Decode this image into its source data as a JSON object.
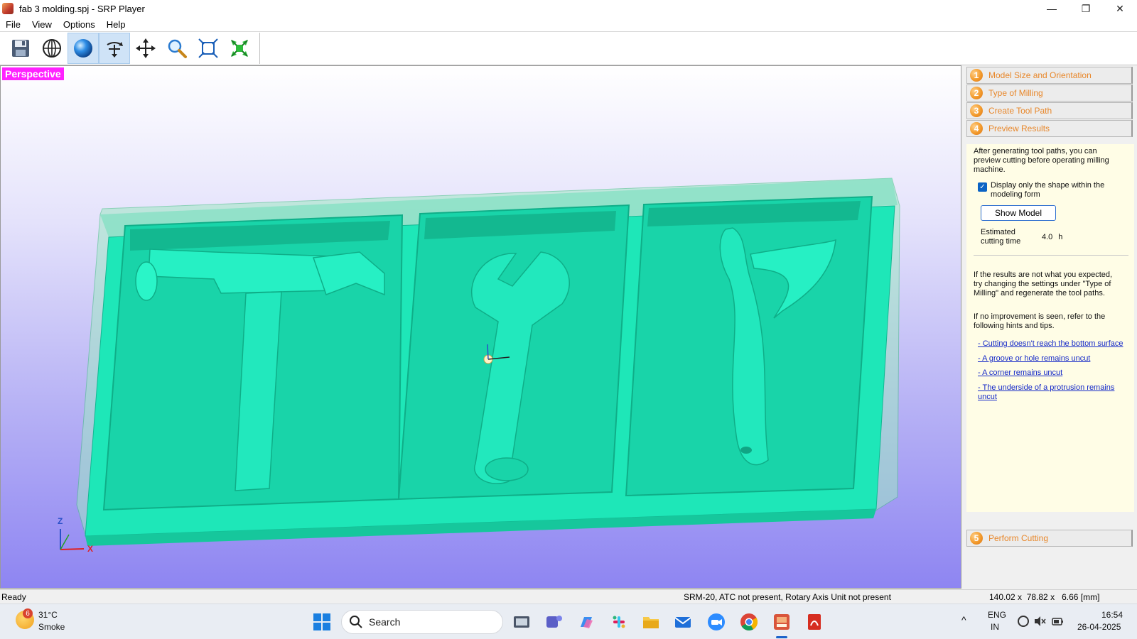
{
  "window": {
    "title": "fab 3 molding.spj - SRP Player",
    "icon": "srp-player-icon",
    "controls": {
      "minimize": "—",
      "maximize": "❐",
      "close": "✕"
    }
  },
  "menu": [
    "File",
    "View",
    "Options",
    "Help"
  ],
  "toolbar": {
    "buttons": [
      "save-icon",
      "wireframe-globe-icon",
      "shaded-sphere-icon",
      "rotate-icon",
      "pan-icon",
      "zoom-icon",
      "fit-view-icon",
      "zoom-extents-icon"
    ],
    "active": [
      "shaded-sphere-icon",
      "rotate-icon"
    ]
  },
  "viewport": {
    "view_label": "Perspective",
    "axes": {
      "z": "Z",
      "x": "X"
    },
    "model_color": "#1de8b9"
  },
  "steps": [
    {
      "num": "1",
      "label": "Model Size and Orientation"
    },
    {
      "num": "2",
      "label": "Type of Milling"
    },
    {
      "num": "3",
      "label": "Create Tool Path"
    },
    {
      "num": "4",
      "label": "Preview Results"
    },
    {
      "num": "5",
      "label": "Perform Cutting"
    }
  ],
  "preview": {
    "intro": "After generating tool paths, you can preview cutting before operating milling machine.",
    "checkbox_label": "Display only the shape within the modeling form",
    "checkbox_checked": true,
    "show_model_button": "Show Model",
    "estimated_label": "Estimated cutting time",
    "estimated_value": "4.0",
    "estimated_unit": "h",
    "hint_text_1": "If the results are not what you expected, try changing the settings under \"Type of Milling\" and regenerate the tool paths.",
    "hint_text_2": "If no improvement is seen, refer to the following hints and tips.",
    "links": [
      "- Cutting doesn't reach the bottom surface",
      "- A groove or hole remains uncut",
      "- A corner remains uncut",
      "- The underside of a protrusion remains uncut"
    ]
  },
  "statusbar": {
    "left": "Ready",
    "machine": "SRM-20, ATC not present, Rotary Axis Unit not present",
    "dimensions": "140.02 x  78.82 x   6.66 [mm]"
  },
  "taskbar": {
    "weather_temp": "31°C",
    "weather_desc": "Smoke",
    "weather_badge": "6",
    "search_placeholder": "Search",
    "apps": [
      "windows-start-icon",
      "task-view-icon",
      "teams-icon",
      "copilot-icon",
      "slack-icon",
      "file-explorer-icon",
      "mail-icon",
      "zoom-icon",
      "chrome-icon",
      "srp-player-icon",
      "pdf-icon"
    ],
    "lang_line1": "ENG",
    "lang_line2": "IN",
    "time": "16:54",
    "date": "26-04-2025"
  }
}
